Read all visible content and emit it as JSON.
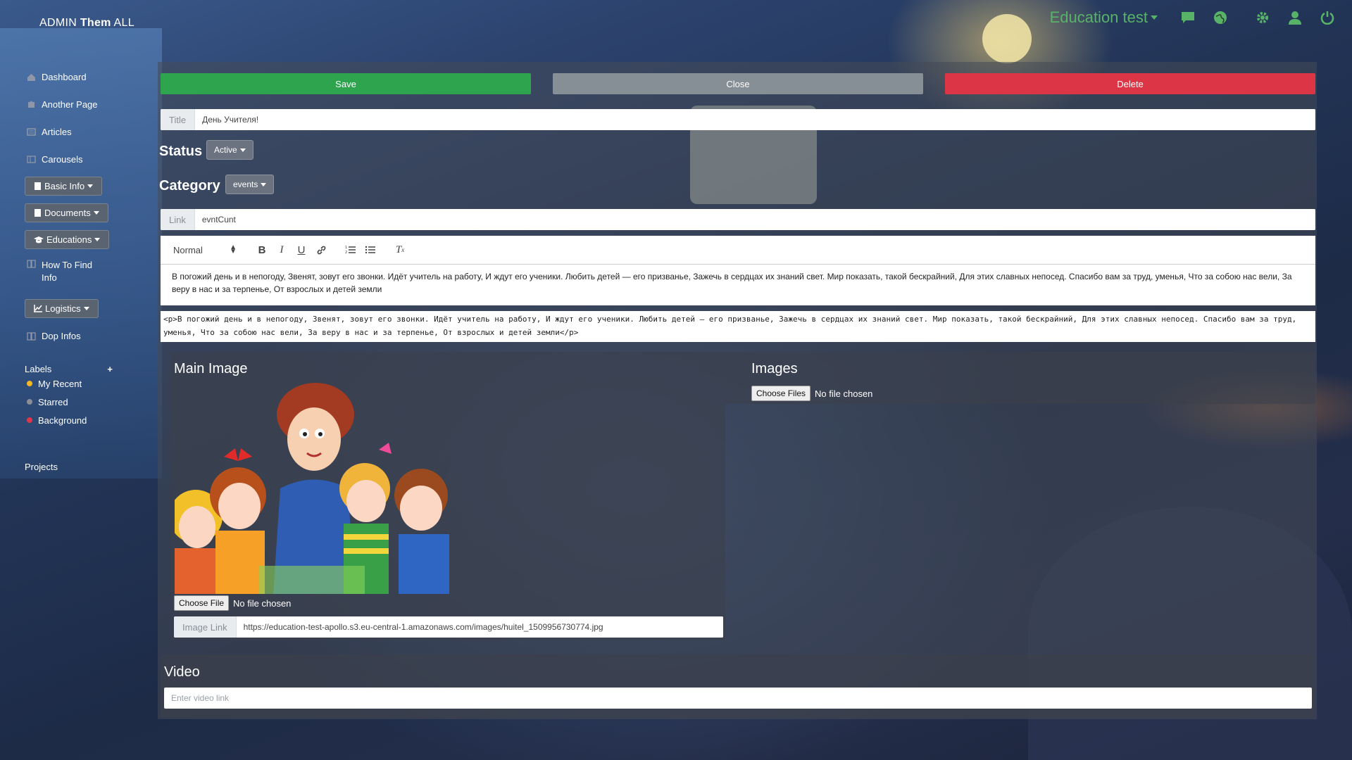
{
  "brand": {
    "prefix": "ADMIN ",
    "bold": "Them",
    "suffix": " ALL"
  },
  "header": {
    "site_name": "Education test"
  },
  "sidebar": {
    "items": [
      {
        "label": "Dashboard"
      },
      {
        "label": "Another Page"
      },
      {
        "label": "Articles"
      },
      {
        "label": "Carousels"
      }
    ],
    "dropdowns": [
      {
        "label": "Basic Info"
      },
      {
        "label": "Documents"
      },
      {
        "label": "Educations"
      }
    ],
    "how_to_find": "How To Find Info",
    "logistics": "Logistics",
    "dop_infos": "Dop Infos",
    "labels_title": "Labels",
    "labels_add": "+",
    "labels": [
      {
        "name": "My Recent",
        "color": "#f2b824"
      },
      {
        "name": "Starred",
        "color": "#8a8f96"
      },
      {
        "name": "Background",
        "color": "#e0364a"
      }
    ],
    "projects": "Projects"
  },
  "actions": {
    "save": "Save",
    "close": "Close",
    "delete": "Delete"
  },
  "form": {
    "title_label": "Title",
    "title_value": "День Учителя!",
    "status_label": "Status",
    "status_value": "Active",
    "category_label": "Category",
    "category_value": "events",
    "link_label": "Link",
    "link_value": "evntCunt"
  },
  "editor": {
    "format": "Normal",
    "content": "В погожий день и в непогоду, Звенят, зовут его звонки. Идёт учитель на работу, И ждут его ученики. Любить детей — его призванье, Зажечь в сердцах их знаний свет. Мир показать, такой бескрайний, Для этих славных непосед. Спасибо вам за труд, уменья, Что за собою нас вели, За веру в нас и за терпенье, От взрослых и детей земли",
    "html_source": "<p>В погожий день и в непогоду, Звенят, зовут его звонки. Идёт учитель на работу, И ждут его ученики. Любить детей — его призванье, Зажечь в сердцах их знаний свет. Мир показать, такой бескрайний, Для этих славных непосед. Спасибо вам за труд, уменья, Что за собою нас вели, За веру в нас и за терпенье, От взрослых и детей земли</p>"
  },
  "main_image": {
    "title": "Main Image",
    "choose": "Choose File",
    "no_file": "No file chosen",
    "link_label": "Image Link",
    "link_value": "https://education-test-apollo.s3.eu-central-1.amazonaws.com/images/huitel_1509956730774.jpg"
  },
  "images": {
    "title": "Images",
    "choose": "Choose Files",
    "no_file": "No file chosen"
  },
  "video": {
    "title": "Video",
    "placeholder": "Enter video link"
  },
  "colors": {
    "save": "#2ea44f",
    "close": "#868e96",
    "delete": "#dc3545",
    "accent": "#58b368"
  }
}
